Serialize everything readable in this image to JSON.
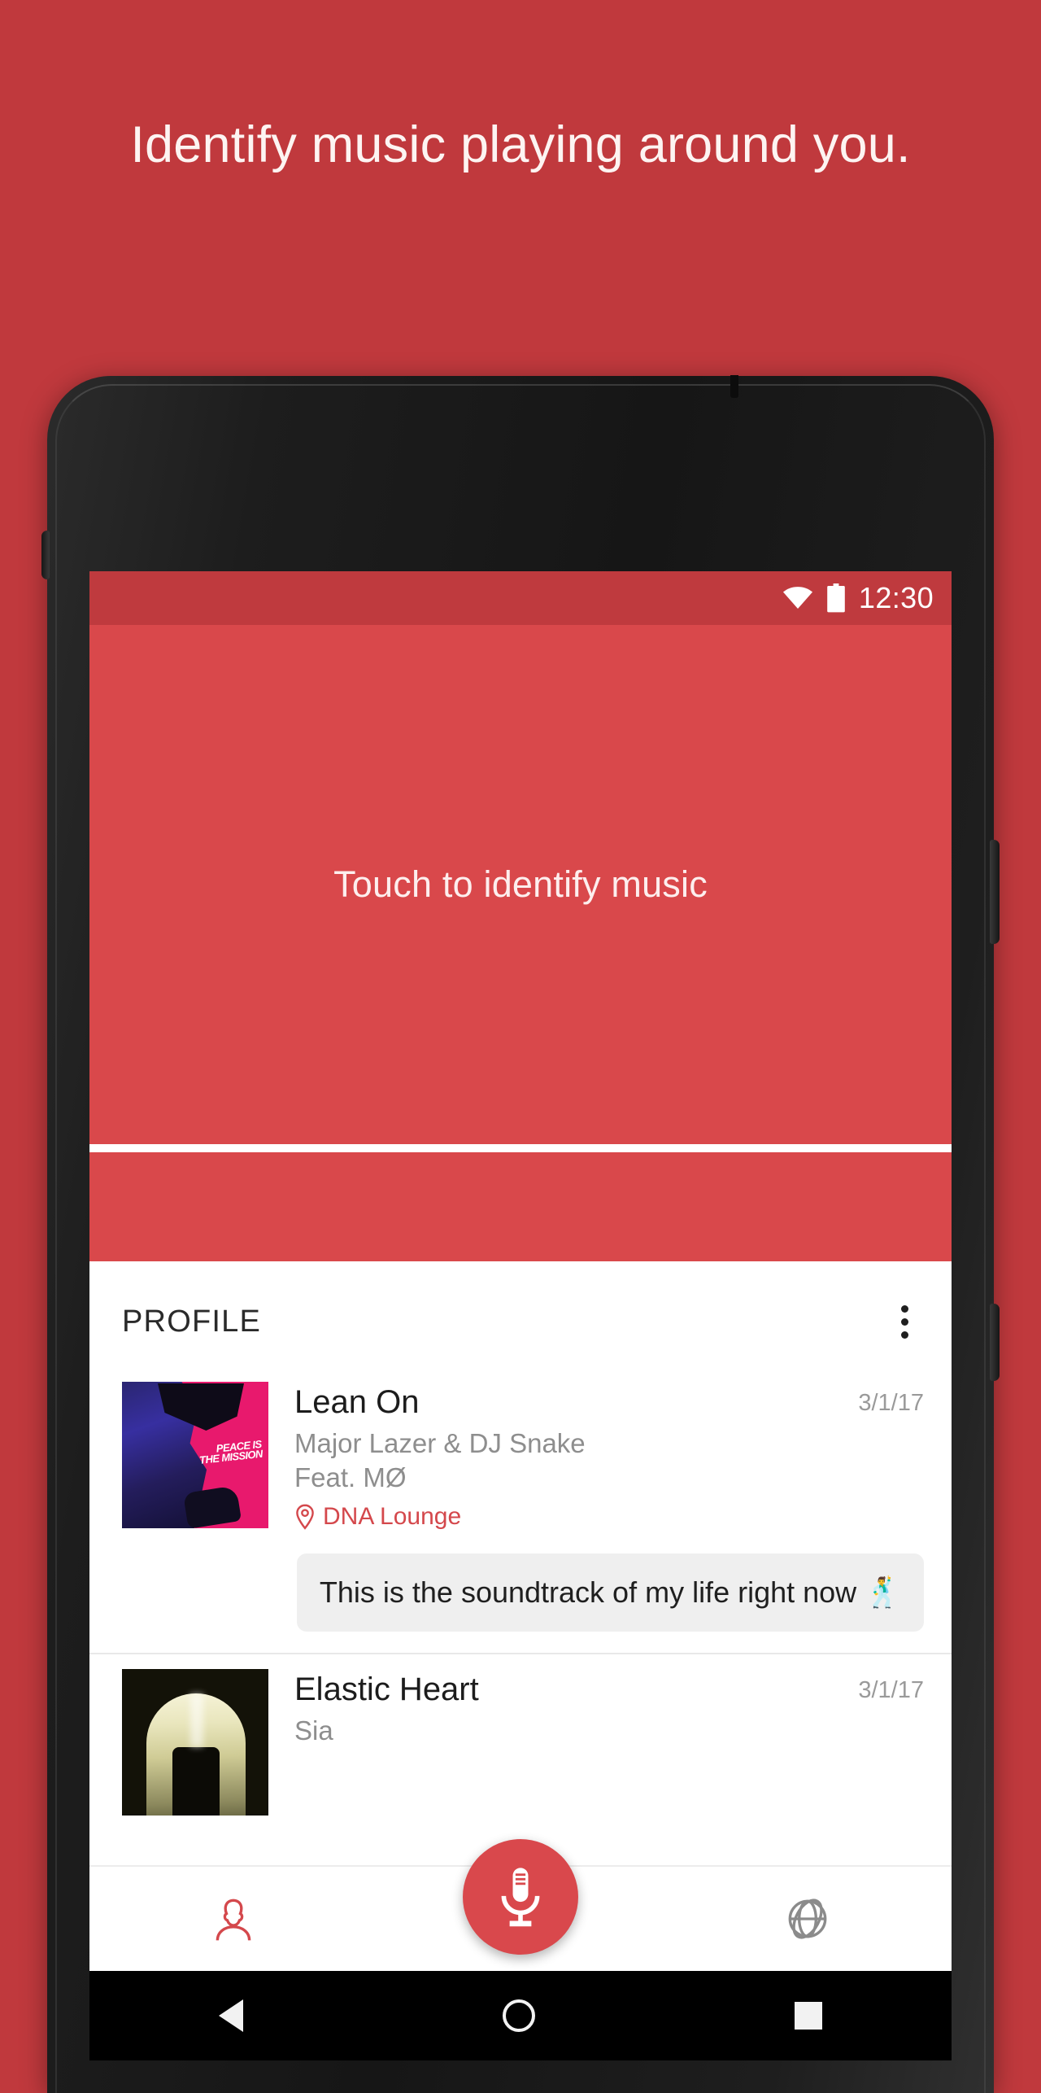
{
  "page": {
    "background_color": "#c0393d",
    "headline": "Identify music playing around you."
  },
  "phone": {
    "status_bar": {
      "wifi_icon": "wifi-icon",
      "battery_icon": "battery-icon",
      "time": "12:30",
      "background_color": "#bf3a3e"
    },
    "identify_panel": {
      "label": "Touch to identify music",
      "background_color": "#d9484b"
    },
    "profile": {
      "section_title": "PROFILE",
      "overflow_menu_icon": "kebab-menu-icon"
    },
    "tracks": [
      {
        "title": "Lean On",
        "artist_line_1": "Major Lazer & DJ Snake",
        "artist_line_2": "Feat. MØ",
        "venue": "DNA Lounge",
        "venue_icon": "location-pin-icon",
        "date": "3/1/17",
        "album_art": "peace-is-the-mission-cover",
        "comment": "This is the soundtrack of my life right now 🕺"
      },
      {
        "title": "Elastic Heart",
        "artist_line_1": "Sia",
        "artist_line_2": "",
        "venue": "",
        "venue_icon": "",
        "date": "3/1/17",
        "album_art": "sia-1000-forms-of-fear-cover",
        "comment": ""
      }
    ],
    "bottom_nav": {
      "left_item": "profile-tab",
      "left_icon": "person-icon",
      "center_item": "identify-fab",
      "center_icon": "microphone-icon",
      "right_item": "explore-tab",
      "right_icon": "globe-icon",
      "accent_color": "#d9484c",
      "inactive_color": "#8b8b8b"
    },
    "android_nav": {
      "back_icon": "back-triangle-icon",
      "home_icon": "home-circle-icon",
      "recents_icon": "recents-square-icon"
    }
  }
}
